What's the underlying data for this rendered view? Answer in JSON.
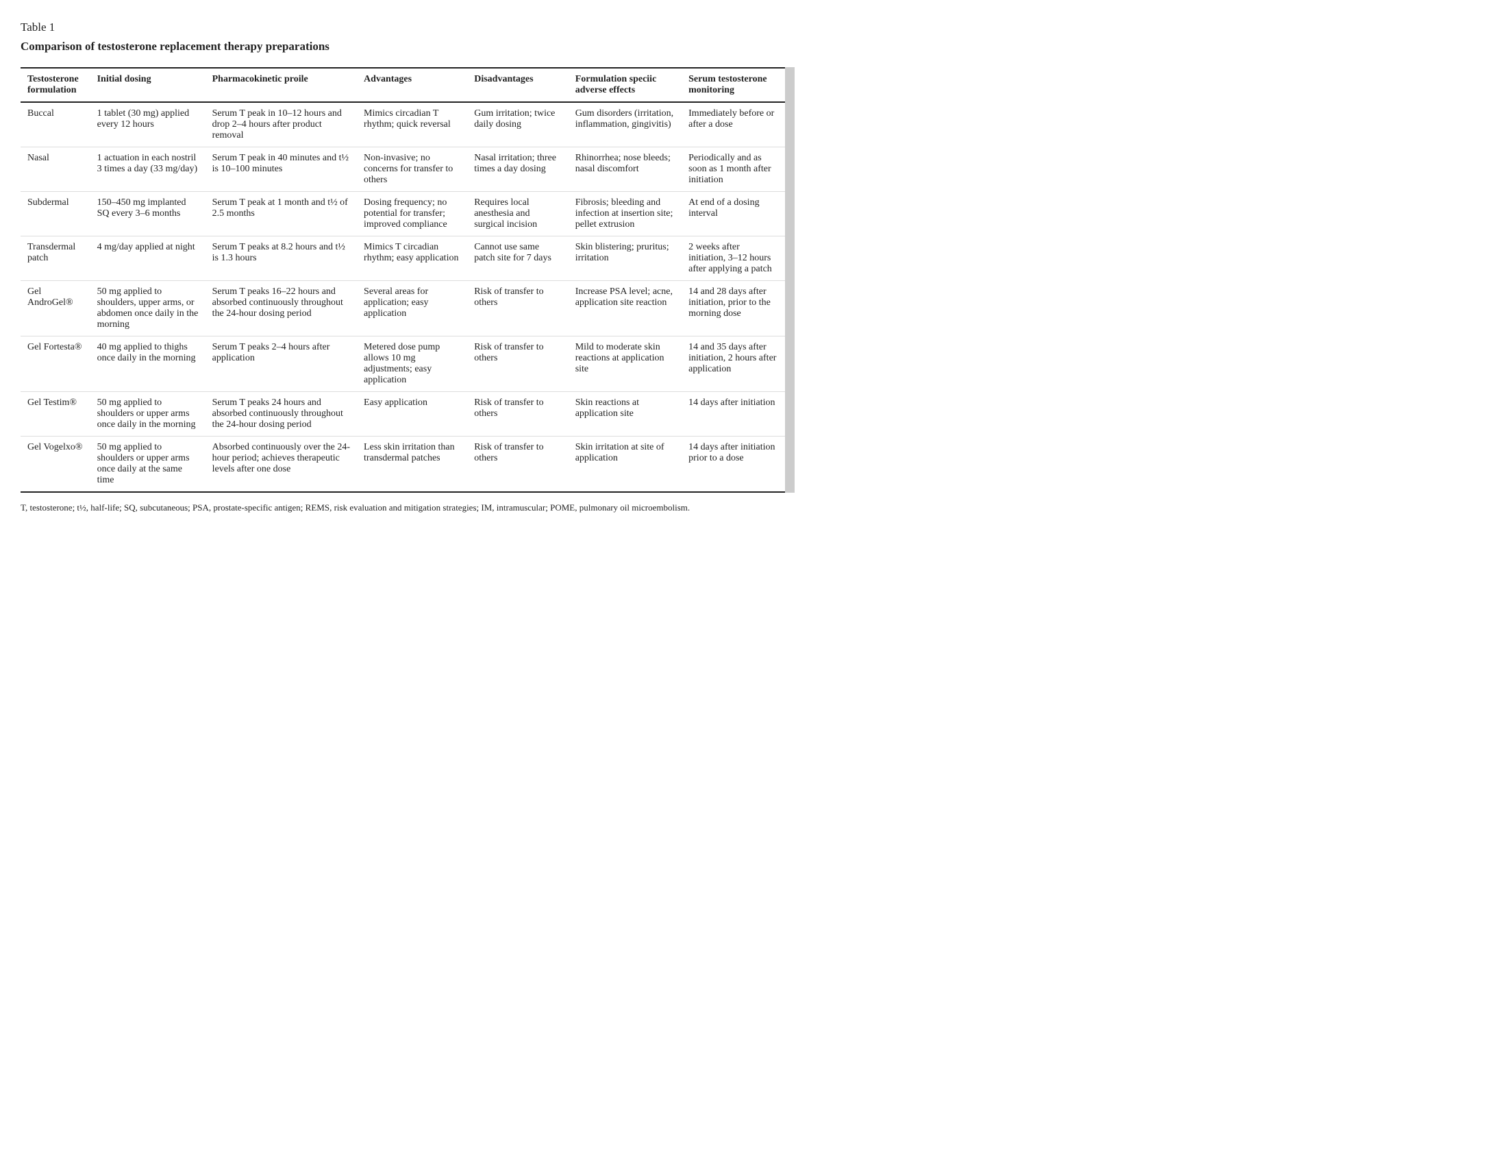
{
  "title": "Table 1",
  "subtitle": "Comparison of testosterone replacement therapy preparations",
  "columns": [
    "Testosterone formulation",
    "Initial dosing",
    "Pharmacokinetic profile",
    "Advantages",
    "Disadvantages",
    "Formulation specific adverse effects",
    "Serum testosterone monitoring"
  ],
  "rows": [
    {
      "formulation": "Buccal",
      "dosing": "1 tablet (30 mg) applied every 12 hours",
      "pk": "Serum T peak in 10–12 hours and drop 2–4 hours after product removal",
      "advantages": "Mimics circadian T rhythm; quick reversal",
      "disadvantages": "Gum irritation; twice daily dosing",
      "adverse": "Gum disorders (irritation, inflammation, gingivitis)",
      "monitoring": "Immediately before or after a dose"
    },
    {
      "formulation": "Nasal",
      "dosing": "1 actuation in each nostril 3 times a day (33 mg/day)",
      "pk": "Serum T peak in 40 minutes and t½ is 10–100 minutes",
      "advantages": "Non-invasive; no concerns for transfer to others",
      "disadvantages": "Nasal irritation; three times a day dosing",
      "adverse": "Rhinorrhea; nose bleeds; nasal discomfort",
      "monitoring": "Periodically and as soon as 1 month after initiation"
    },
    {
      "formulation": "Subdermal",
      "dosing": "150–450 mg implanted SQ every 3–6 months",
      "pk": "Serum T peak at 1 month and t½ of 2.5 months",
      "advantages": "Dosing frequency; no potential for transfer; improved compliance",
      "disadvantages": "Requires local anesthesia and surgical incision",
      "adverse": "Fibrosis; bleeding and infection at insertion site; pellet extrusion",
      "monitoring": "At end of a dosing interval"
    },
    {
      "formulation": "Transdermal patch",
      "dosing": "4 mg/day applied at night",
      "pk": "Serum T peaks at 8.2 hours and t½ is 1.3 hours",
      "advantages": "Mimics T circadian rhythm; easy application",
      "disadvantages": "Cannot use same patch site for 7 days",
      "adverse": "Skin blistering; pruritus; irritation",
      "monitoring": "2 weeks after initiation, 3–12 hours after applying a patch"
    },
    {
      "formulation": "Gel AndroGel®",
      "dosing": "50 mg applied to shoulders, upper arms, or abdomen once daily in the morning",
      "pk": "Serum T peaks 16–22 hours and absorbed continuously throughout the 24-hour dosing period",
      "advantages": "Several areas for application; easy application",
      "disadvantages": "Risk of transfer to others",
      "adverse": "Increase PSA level; acne, application site reaction",
      "monitoring": "14 and 28 days after initiation, prior to the morning dose"
    },
    {
      "formulation": "Gel Fortesta®",
      "dosing": "40 mg applied to thighs once daily in the morning",
      "pk": "Serum T peaks 2–4 hours after application",
      "advantages": "Metered dose pump allows 10 mg adjustments; easy application",
      "disadvantages": "Risk of transfer to others",
      "adverse": "Mild to moderate skin reactions at application site",
      "monitoring": "14 and 35 days after initiation, 2 hours after application"
    },
    {
      "formulation": "Gel Testim®",
      "dosing": "50 mg applied to shoulders or upper arms once daily in the morning",
      "pk": "Serum T peaks 24 hours and absorbed continuously throughout the 24-hour dosing period",
      "advantages": "Easy application",
      "disadvantages": "Risk of transfer to others",
      "adverse": "Skin reactions at application site",
      "monitoring": "14 days after initiation"
    },
    {
      "formulation": "Gel Vogelxo®",
      "dosing": "50 mg applied to shoulders or upper arms once daily at the same time",
      "pk": "Absorbed continuously over the 24-hour period; achieves therapeutic levels after one dose",
      "advantages": "Less skin irritation than transdermal patches",
      "disadvantages": "Risk of transfer to others",
      "adverse": "Skin irritation at site of application",
      "monitoring": "14 days after initiation prior to a dose"
    }
  ],
  "footer": "T, testosterone; t½, half-life; SQ, subcutaneous; PSA, prostate-specific antigen; REMS, risk evaluation and mitigation strategies; IM, intramuscular; POME, pulmonary oil microembolism."
}
